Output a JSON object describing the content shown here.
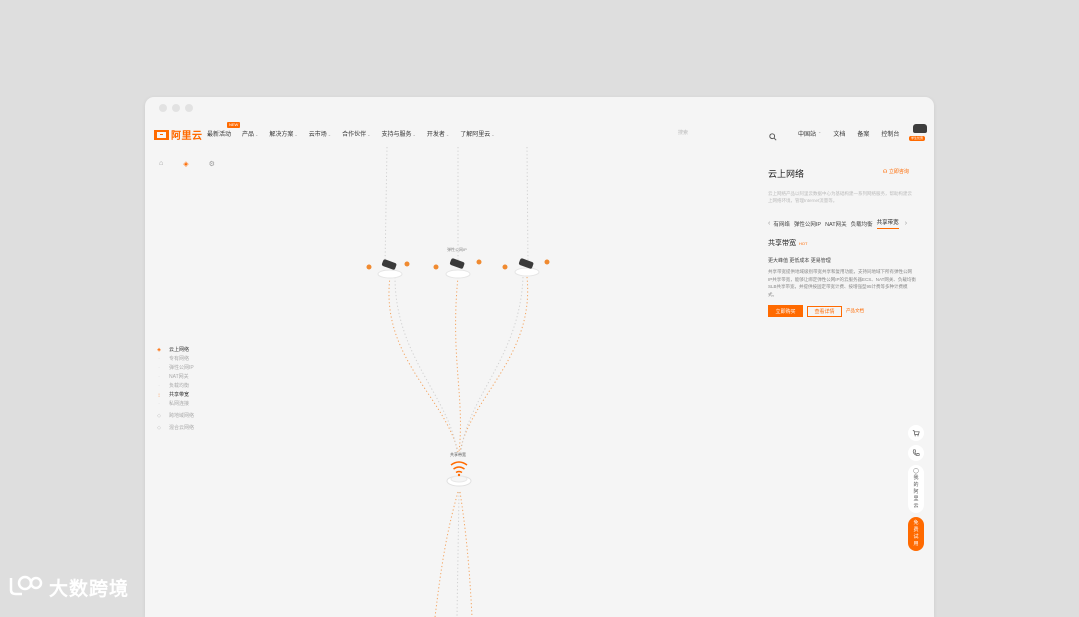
{
  "nav": {
    "logo": "阿里云",
    "items": [
      {
        "label": "最新活动",
        "caret": false,
        "badge": "NEW"
      },
      {
        "label": "产品",
        "caret": true
      },
      {
        "label": "解决方案",
        "caret": true
      },
      {
        "label": "云市场",
        "caret": true
      },
      {
        "label": "合作伙伴",
        "caret": true
      },
      {
        "label": "支持与服务",
        "caret": true
      },
      {
        "label": "开发者",
        "caret": true
      },
      {
        "label": "了解阿里云",
        "caret": true
      }
    ],
    "search_placeholder": "搜索",
    "right": [
      "中国站",
      "文档",
      "备案",
      "控制台"
    ],
    "avatar_tag": "学生优惠"
  },
  "diagram": {
    "eip_label": "弹性公网IP",
    "bandwidth_label": "共享带宽"
  },
  "left_menu": [
    {
      "label": "云上网络",
      "level": 0,
      "active": true
    },
    {
      "label": "专有网络",
      "level": 1
    },
    {
      "label": "弹性公网IP",
      "level": 1
    },
    {
      "label": "NAT网关",
      "level": 1
    },
    {
      "label": "负载均衡",
      "level": 1
    },
    {
      "label": "共享带宽",
      "level": 1,
      "active": true
    },
    {
      "label": "私网连接",
      "level": 1
    },
    {
      "label": "跨地域网络",
      "level": 0
    },
    {
      "label": "混合云网络",
      "level": 0
    }
  ],
  "panel": {
    "title": "云上网络",
    "consult": "立即咨询",
    "description": "云上网络产品以阿里云数据中心为基础构建一系列网络服务，帮助构建云上网络环境，管理Internet流量等。",
    "tabs": [
      "有网络",
      "弹性公网IP",
      "NAT网关",
      "负载均衡",
      "共享带宽"
    ],
    "active_tab": 4,
    "section_title": "共享带宽",
    "hot": "HOT",
    "subtitle": "更大峰值 更低成本 更易管理",
    "body": "共享带宽提供地域级别带宽共享和复用功能，支持同地域下所有弹性公网IP共享带宽，能够让绑定弹性公网IP的云服务器ECS、NAT网关、负载均衡SLB共享带宽，并提供按固定带宽计费、按增强型95计费等多种计费模式。",
    "btn_primary": "立即购买",
    "btn_outline": "查看详情",
    "link": "产品文档"
  },
  "float_bar": {
    "my_aliyun": [
      "我",
      "的",
      "阿",
      "里",
      "云"
    ],
    "promo": [
      "免",
      "费",
      "试",
      "用"
    ]
  },
  "watermark": "大数跨境"
}
